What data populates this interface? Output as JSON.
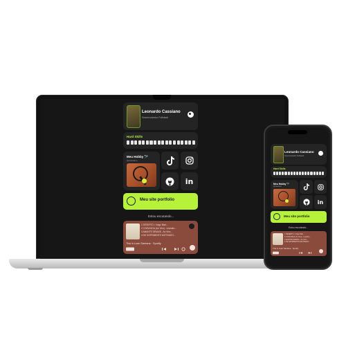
{
  "profile": {
    "name": "Leonardo Cassiano",
    "role": "Desenvolvedor Fullstack"
  },
  "skills": {
    "title": "Hard Skills",
    "count": 18
  },
  "hobby": {
    "title": "Meu Hobby 🎾",
    "handle": "@lcassiano"
  },
  "social": {
    "tiktok_icon": "tiktok-icon",
    "instagram_icon": "instagram-icon",
    "github_icon": "github-icon",
    "linkedin_icon": "linkedin-icon",
    "linkedin_glyph": "in"
  },
  "site": {
    "label": "Meu site portfolio"
  },
  "listening": {
    "title": "Estou escutando..."
  },
  "spotify": {
    "tracks": [
      "1  DESERTO • Vulgo Mari...",
      "2  COISA BOA (Ao Vivo) - Leandro...",
      "3  AMANTE DEMAIS - Ao Vivo...",
      "4  DE SOFRIMENTO MOTIVADO..."
    ],
    "playlist": "This is Luan Santana · Spotify",
    "save_label": "Salvar"
  },
  "colors": {
    "accent": "#b7f23a",
    "card": "#242424",
    "spotify_bg": "#8a4a3c",
    "screen_bg": "#161616"
  }
}
